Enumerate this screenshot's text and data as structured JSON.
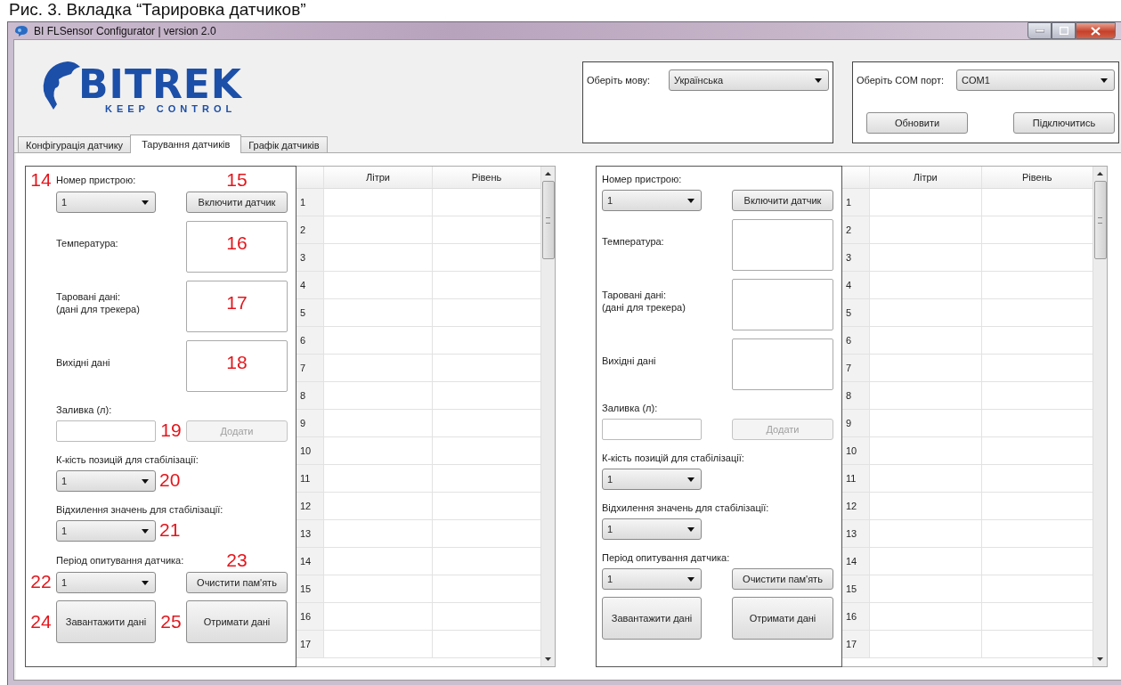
{
  "caption": "Рис. 3. Вкладка “Тарировка датчиков”",
  "window": {
    "title": "BI FLSensor Configurator | version 2.0"
  },
  "logo": {
    "wordmark": "BITREK",
    "tagline": "KEEP CONTROL"
  },
  "language": {
    "label": "Оберіть мову:",
    "value": "Українська"
  },
  "port": {
    "label": "Оберіть COM порт:",
    "value": "COM1",
    "buttons": [
      "Обновити",
      "Підключитись"
    ]
  },
  "tabs": [
    {
      "label": "Конфігурація датчику",
      "selected": false
    },
    {
      "label": "Тарування датчиків",
      "selected": true
    },
    {
      "label": "Графік датчиків",
      "selected": false
    }
  ],
  "panels": [
    {
      "device": {
        "label": "Номер пристрою:",
        "value": "1",
        "marker": "14"
      },
      "enable_button": {
        "label": "Включити датчик",
        "marker": "15"
      },
      "readouts": [
        {
          "label": "Температура:",
          "marker": "16"
        },
        {
          "label": "Таровані дані:\n(дані для трекера)",
          "marker": "17"
        },
        {
          "label": "Вихідні дані",
          "marker": "18"
        }
      ],
      "fill": {
        "label": "Заливка (л):",
        "marker": "19",
        "button": {
          "label": "Додати",
          "disabled": true
        }
      },
      "selects": [
        {
          "label": "К-кість позицій для стабілізації:",
          "value": "1",
          "marker": "20"
        },
        {
          "label": "Відхилення значень для стабілізації:",
          "value": "1",
          "marker": "21"
        }
      ],
      "period": {
        "label": "Період опитування датчика:",
        "value": "1",
        "marker": "22"
      },
      "clear_button": {
        "label": "Очистити пам'ять",
        "marker": "23"
      },
      "load_button": {
        "label": "Завантажити дані",
        "marker": "24"
      },
      "get_button": {
        "label": "Отримати дані",
        "marker": "25"
      },
      "table": {
        "columns": [
          "Літри",
          "Рівень"
        ],
        "rows": [
          "1",
          "2",
          "3",
          "4",
          "5",
          "6",
          "7",
          "8",
          "9",
          "10",
          "11",
          "12",
          "13",
          "14",
          "15",
          "16",
          "17"
        ]
      }
    },
    {
      "device": {
        "label": "Номер пристрою:",
        "value": "1"
      },
      "enable_button": {
        "label": "Включити датчик"
      },
      "readouts": [
        {
          "label": "Температура:"
        },
        {
          "label": "Таровані дані:\n(дані для трекера)"
        },
        {
          "label": "Вихідні дані"
        }
      ],
      "fill": {
        "label": "Заливка (л):",
        "button": {
          "label": "Додати",
          "disabled": true
        }
      },
      "selects": [
        {
          "label": "К-кість позицій для стабілізації:",
          "value": "1"
        },
        {
          "label": "Відхилення значень для стабілізації:",
          "value": "1"
        }
      ],
      "period": {
        "label": "Період опитування датчика:",
        "value": "1"
      },
      "clear_button": {
        "label": "Очистити пам'ять"
      },
      "load_button": {
        "label": "Завантажити дані"
      },
      "get_button": {
        "label": "Отримати дані"
      },
      "table": {
        "columns": [
          "Літри",
          "Рівень"
        ],
        "rows": [
          "1",
          "2",
          "3",
          "4",
          "5",
          "6",
          "7",
          "8",
          "9",
          "10",
          "11",
          "12",
          "13",
          "14",
          "15",
          "16",
          "17"
        ]
      }
    }
  ]
}
